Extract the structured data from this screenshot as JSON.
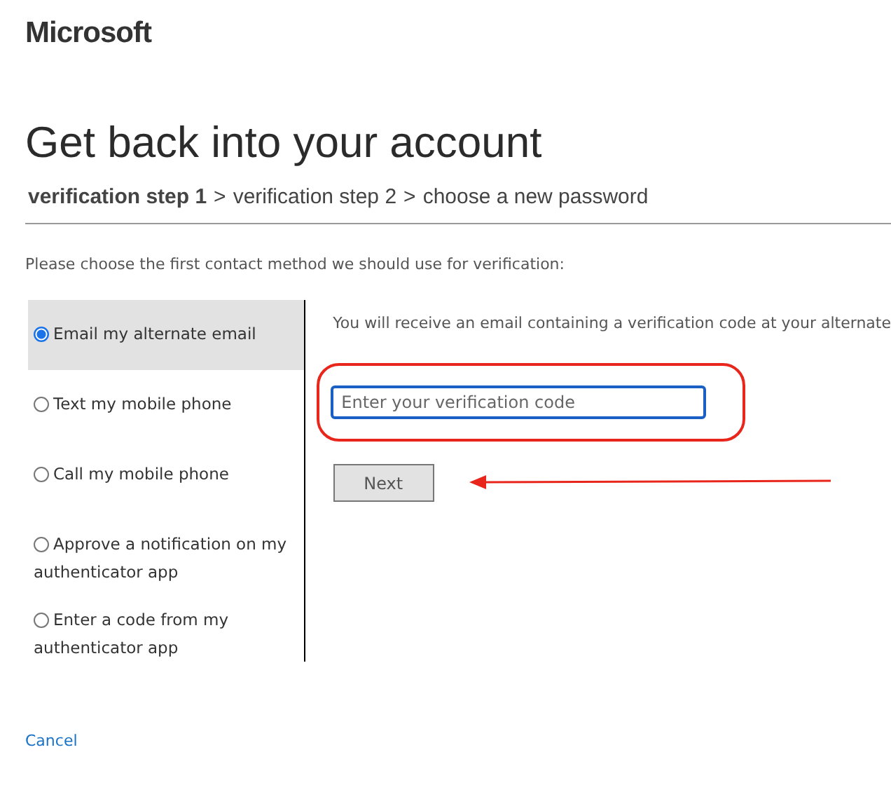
{
  "brand": {
    "name": "Microsoft"
  },
  "title": "Get back into your account",
  "breadcrumb": {
    "separator": ">",
    "steps": [
      {
        "label": "verification step 1",
        "selected": true
      },
      {
        "label": "verification step 2",
        "selected": false
      },
      {
        "label": "choose a new password",
        "selected": false
      }
    ]
  },
  "instruction": "Please choose the first contact method we should use for verification:",
  "methods": [
    {
      "label": "Email my alternate email",
      "selected": true
    },
    {
      "label": "Text my mobile phone",
      "selected": false
    },
    {
      "label": "Call my mobile phone",
      "selected": false
    },
    {
      "label": "Approve a notification on my authenticator app",
      "selected": false
    },
    {
      "label": "Enter a code from my authenticator app",
      "selected": false
    }
  ],
  "info": "You will receive an email containing a verification code at your alternate",
  "code_field": {
    "placeholder": "Enter your verification code"
  },
  "next_button": "Next",
  "cancel_link": "Cancel"
}
